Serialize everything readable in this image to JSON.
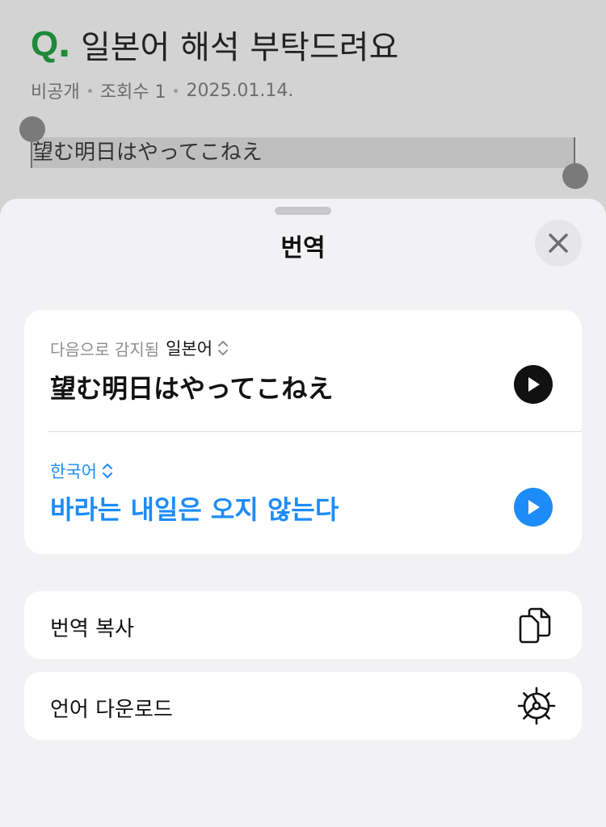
{
  "background": {
    "question_mark": "Q",
    "question_dot": ".",
    "title": "일본어 해석 부탁드려요",
    "meta": {
      "visibility": "비공개",
      "views": "조회수 1",
      "date": "2025.01.14."
    },
    "selected_text": "望む明日はやってこねえ"
  },
  "sheet": {
    "title": "번역",
    "close_icon": "close-icon",
    "source": {
      "detected_label": "다음으로 감지됨",
      "language": "일본어",
      "text": "望む明日はやってこねえ"
    },
    "target": {
      "language": "한국어",
      "text": "바라는 내일은 오지 않는다"
    },
    "actions": [
      {
        "label": "번역 복사",
        "icon": "copy-icon"
      },
      {
        "label": "언어 다운로드",
        "icon": "download-gear-icon"
      }
    ]
  },
  "colors": {
    "accent_blue": "#1d8cf8",
    "brand_green": "#1e8a3a"
  }
}
